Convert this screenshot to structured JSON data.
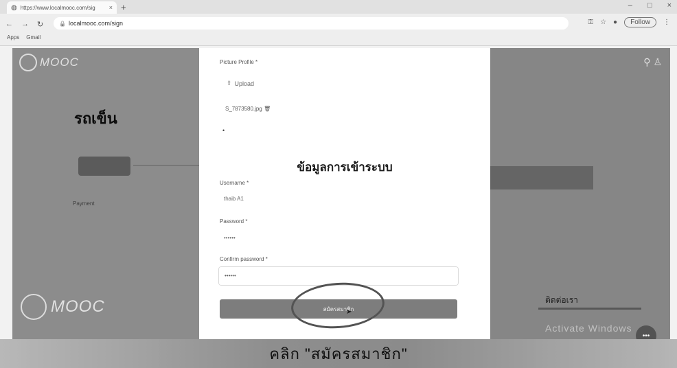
{
  "browser": {
    "tab_title": "https://www.localmooc.com/sig",
    "tab_close": "×",
    "new_tab": "+",
    "url": "localmooc.com/sign",
    "follow_label": "Follow",
    "bookmarks": [
      "Apps",
      "Gmail"
    ],
    "window_controls": [
      "–",
      "□",
      "×"
    ]
  },
  "left_panel": {
    "logo_text": "MOOC",
    "title": "รถเข็น",
    "link_text": "Payment",
    "bottom_logo_text": "MOOC"
  },
  "right_panel": {
    "footer_title": "ติดต่อเรา"
  },
  "form": {
    "picture_label": "Picture Profile *",
    "upload_label": "Upload",
    "filename": "S_7873580.jpg",
    "section_title": "ข้อมูลการเข้าระบบ",
    "username_label": "Username *",
    "username_value": "thaib A1",
    "password_label": "Password *",
    "password_value": "••••••",
    "confirm_label": "Confirm password *",
    "confirm_value": "••••••",
    "submit_label": "สมัครสมาชิก"
  },
  "caption": "คลิก \"สมัครสมาชิก\"",
  "watermark": "Activate Windows"
}
